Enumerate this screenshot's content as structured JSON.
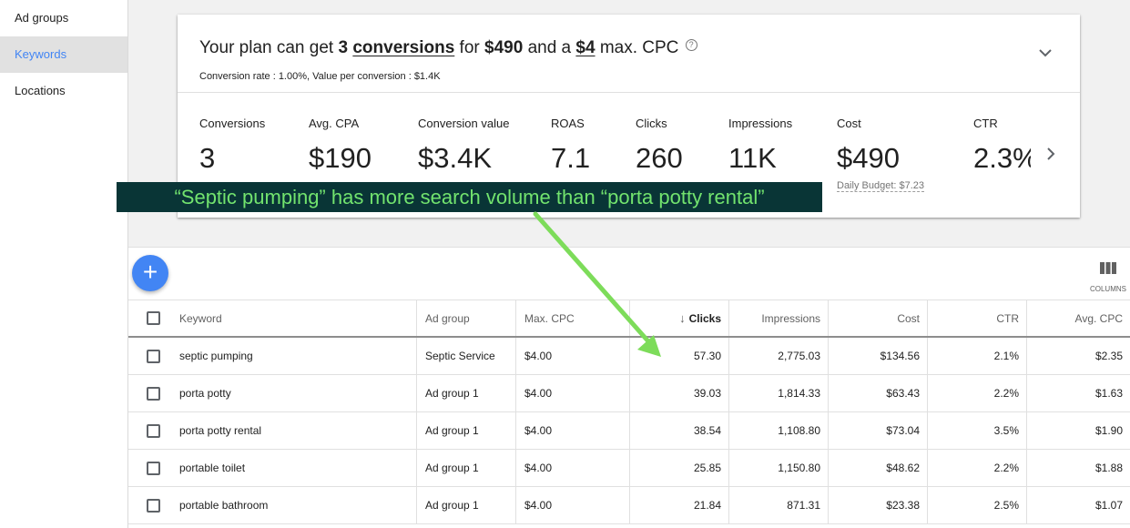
{
  "sidebar": {
    "items": [
      {
        "label": "Ad groups",
        "active": false
      },
      {
        "label": "Keywords",
        "active": true
      },
      {
        "label": "Locations",
        "active": false
      }
    ]
  },
  "plan": {
    "headline_prefix": "Your plan can get ",
    "conversions_count": "3",
    "conversions_word": "conversions",
    "headline_for": " for ",
    "budget_amount": "$490",
    "headline_and": " and a ",
    "max_cpc": "$4",
    "headline_suffix": " max. CPC",
    "help_glyph": "?",
    "subline": "Conversion rate : 1.00%, Value per conversion : $1.4K",
    "collapse_glyph": "⌄",
    "metrics": [
      {
        "label": "Conversions",
        "value": "3"
      },
      {
        "label": "Avg. CPA",
        "value": "$190"
      },
      {
        "label": "Conversion value",
        "value": "$3.4K"
      },
      {
        "label": "ROAS",
        "value": "7.1"
      },
      {
        "label": "Clicks",
        "value": "260"
      },
      {
        "label": "Impressions",
        "value": "11K"
      },
      {
        "label": "Cost",
        "value": "$490"
      },
      {
        "label": "CTR",
        "value": "2.3%"
      }
    ],
    "daily_budget": "Daily Budget: $7.23",
    "next_glyph": "›"
  },
  "callout": {
    "text": "“Septic pumping” has more search volume than “porta potty rental”"
  },
  "toolbar": {
    "add_glyph": "+",
    "columns_label": "COLUMNS"
  },
  "table": {
    "columns": [
      "Keyword",
      "Ad group",
      "Max. CPC",
      "Clicks",
      "Impressions",
      "Cost",
      "CTR",
      "Avg. CPC"
    ],
    "sort_glyph": "↓",
    "rows": [
      {
        "keyword": "septic pumping",
        "ad_group": "Septic Service",
        "max_cpc": "$4.00",
        "clicks": "57.30",
        "impressions": "2,775.03",
        "cost": "$134.56",
        "ctr": "2.1%",
        "avg_cpc": "$2.35"
      },
      {
        "keyword": "porta potty",
        "ad_group": "Ad group 1",
        "max_cpc": "$4.00",
        "clicks": "39.03",
        "impressions": "1,814.33",
        "cost": "$63.43",
        "ctr": "2.2%",
        "avg_cpc": "$1.63"
      },
      {
        "keyword": "porta potty rental",
        "ad_group": "Ad group 1",
        "max_cpc": "$4.00",
        "clicks": "38.54",
        "impressions": "1,108.80",
        "cost": "$73.04",
        "ctr": "3.5%",
        "avg_cpc": "$1.90"
      },
      {
        "keyword": "portable toilet",
        "ad_group": "Ad group 1",
        "max_cpc": "$4.00",
        "clicks": "25.85",
        "impressions": "1,150.80",
        "cost": "$48.62",
        "ctr": "2.2%",
        "avg_cpc": "$1.88"
      },
      {
        "keyword": "portable bathroom",
        "ad_group": "Ad group 1",
        "max_cpc": "$4.00",
        "clicks": "21.84",
        "impressions": "871.31",
        "cost": "$23.38",
        "ctr": "2.5%",
        "avg_cpc": "$1.07"
      }
    ]
  },
  "colors": {
    "accent": "#4285f4",
    "callout_bg": "#093536",
    "callout_text": "#72e36e",
    "arrow": "#7ddc5a"
  }
}
